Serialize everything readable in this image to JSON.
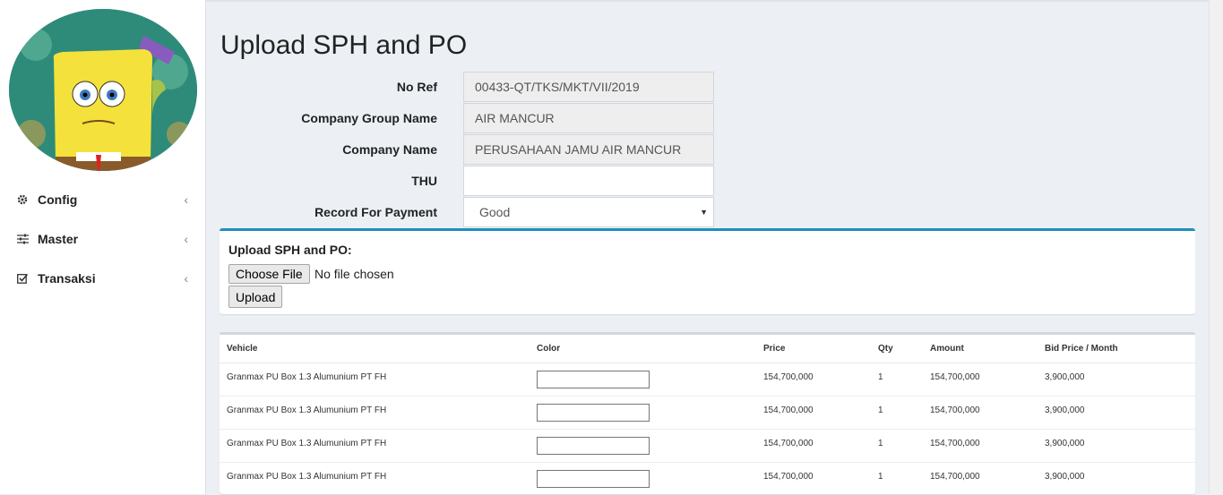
{
  "sidebar": {
    "avatar_label": "user-avatar",
    "items": [
      {
        "label": "Config",
        "icon": "gear-icon"
      },
      {
        "label": "Master",
        "icon": "sliders-icon"
      },
      {
        "label": "Transaksi",
        "icon": "check-square-icon"
      }
    ],
    "chevron": "‹"
  },
  "page": {
    "title": "Upload SPH and PO"
  },
  "form": {
    "no_ref": {
      "label": "No Ref",
      "value": "00433-QT/TKS/MKT/VII/2019"
    },
    "company_group": {
      "label": "Company Group Name",
      "value": "AIR MANCUR"
    },
    "company_name": {
      "label": "Company Name",
      "value": "PERUSAHAAN JAMU AIR MANCUR"
    },
    "thu": {
      "label": "THU",
      "value": ""
    },
    "record_for_payment": {
      "label": "Record For Payment",
      "value": "Good"
    }
  },
  "upload": {
    "label": "Upload SPH and PO:",
    "choose_file": "Choose File",
    "status": "No file chosen",
    "upload_button": "Upload"
  },
  "table": {
    "columns": [
      "Vehicle",
      "Color",
      "Price",
      "Qty",
      "Amount",
      "Bid Price / Month"
    ],
    "rows": [
      {
        "vehicle": "Granmax PU Box 1.3 Alumunium PT FH",
        "color": "",
        "price": "154,700,000",
        "qty": "1",
        "amount": "154,700,000",
        "bid": "3,900,000"
      },
      {
        "vehicle": "Granmax PU Box 1.3 Alumunium PT FH",
        "color": "",
        "price": "154,700,000",
        "qty": "1",
        "amount": "154,700,000",
        "bid": "3,900,000"
      },
      {
        "vehicle": "Granmax PU Box 1.3 Alumunium PT FH",
        "color": "",
        "price": "154,700,000",
        "qty": "1",
        "amount": "154,700,000",
        "bid": "3,900,000"
      },
      {
        "vehicle": "Granmax PU Box 1.3 Alumunium PT FH",
        "color": "",
        "price": "154,700,000",
        "qty": "1",
        "amount": "154,700,000",
        "bid": "3,900,000"
      }
    ]
  },
  "colors": {
    "accent": "#1c8fbb",
    "background": "#ecf0f5",
    "sidebar": "#ffffff"
  }
}
